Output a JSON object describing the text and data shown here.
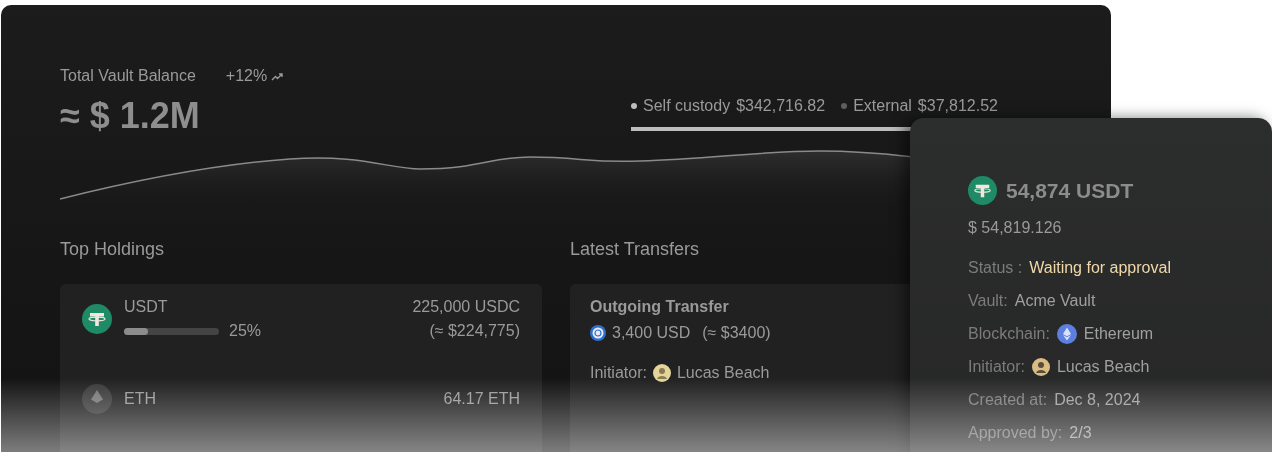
{
  "balance": {
    "label": "Total Vault Balance",
    "change": "+12%",
    "amount": "≈ $ 1.2M"
  },
  "custody": {
    "level": 0.9,
    "items": [
      {
        "label": "Self custody",
        "value": "$342,716.82",
        "color": "#bdbdbd"
      },
      {
        "label": "External",
        "value": "$37,812.52",
        "color": "#5e5e5e"
      }
    ]
  },
  "holdings": {
    "title": "Top Holdings",
    "items": [
      {
        "symbol": "USDT",
        "kind": "tether",
        "level": 0.25,
        "share": "25%",
        "amount": "225,000 USDC",
        "usd": "(≈ $224,775)"
      },
      {
        "symbol": "ETH",
        "kind": "ether",
        "amount": "64.17 ETH"
      }
    ]
  },
  "transfers": {
    "title": "Latest Transfers",
    "items": [
      {
        "type": "Outgoing Transfer",
        "kind": "usdc",
        "amount": "3,400 USD",
        "usd": "(≈ $3400)",
        "initiator_label": "Initiator:",
        "initiator": "Lucas Beach"
      }
    ]
  },
  "detail": {
    "kind": "tether",
    "amount": "54,874 USDT",
    "usd": "$ 54,819.126",
    "fields": [
      {
        "kind": "status",
        "label": "Status :",
        "value": "Waiting for approval"
      },
      {
        "kind": "text",
        "label": "Vault:",
        "value": "Acme Vault"
      },
      {
        "kind": "chain",
        "label": "Blockchain:",
        "value": "Ethereum"
      },
      {
        "kind": "person",
        "label": "Initiator:",
        "value": "Lucas Beach"
      },
      {
        "kind": "text",
        "label": "Created at:",
        "value": "Dec 8, 2024"
      },
      {
        "kind": "text",
        "label": "Approved by:",
        "value": "2/3"
      }
    ]
  }
}
